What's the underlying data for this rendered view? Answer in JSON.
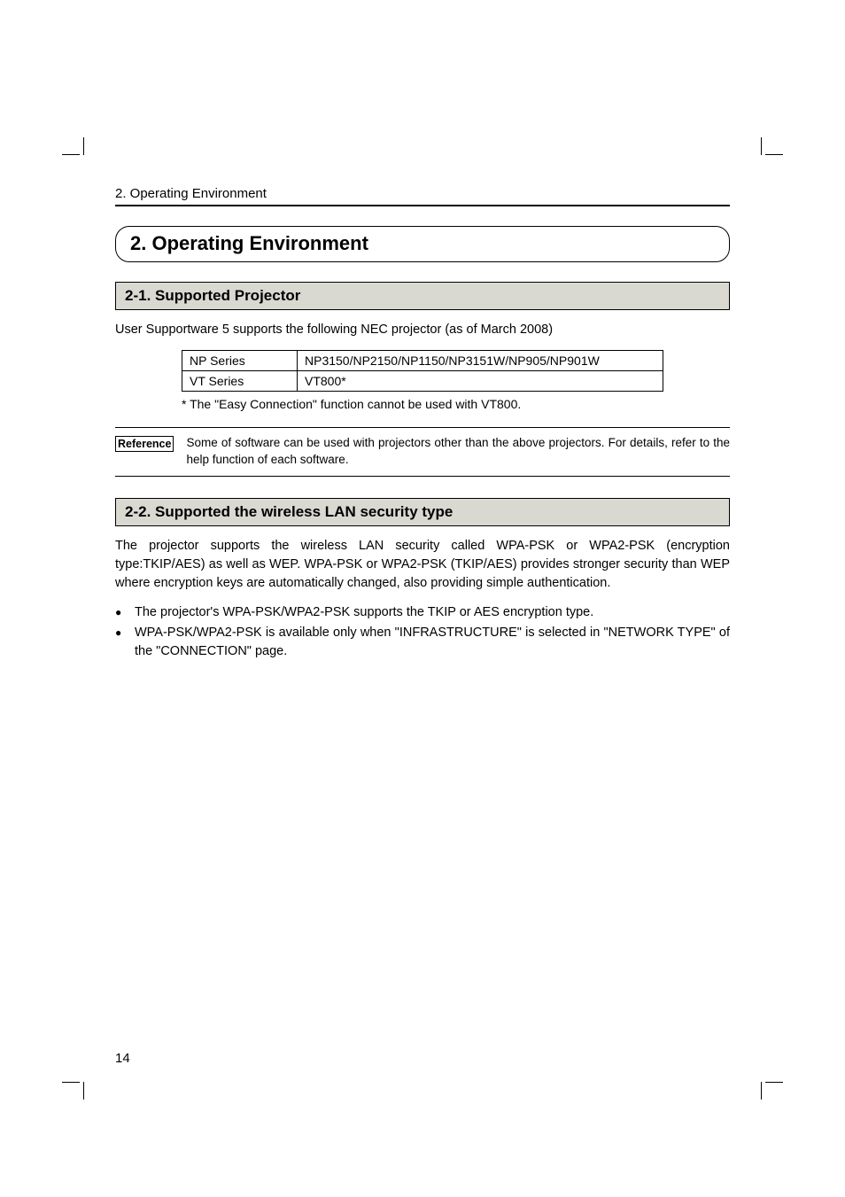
{
  "runningHead": "2. Operating Environment",
  "chapterTitle": "2. Operating Environment",
  "section1": {
    "heading": "2-1.  Supported Projector",
    "intro": "User Supportware 5 supports the following NEC projector (as of March 2008)",
    "table": {
      "rows": [
        {
          "series": "NP Series",
          "models": "NP3150/NP2150/NP1150/NP3151W/NP905/NP901W"
        },
        {
          "series": "VT Series",
          "models": "VT800*"
        }
      ]
    },
    "tableNote": "* The \"Easy Connection\" function cannot be used with VT800.",
    "reference": {
      "badge": "Reference",
      "text": "Some of software can be used with projectors other than the above projectors.  For details, refer to the help function of each software."
    }
  },
  "section2": {
    "heading": "2-2.  Supported the wireless LAN security type",
    "para": "The projector supports the wireless LAN security called WPA-PSK or WPA2-PSK (encryption type:TKIP/AES) as well as WEP. WPA-PSK or WPA2-PSK (TKIP/AES) provides stronger security than WEP where encryption keys are automatically changed, also providing simple authentication.",
    "bullets": [
      "The projector's WPA-PSK/WPA2-PSK supports the TKIP or AES encryption type.",
      "WPA-PSK/WPA2-PSK is available only when \"INFRASTRUCTURE\" is selected in \"NETWORK TYPE\" of the \"CONNECTION\" page."
    ]
  },
  "pageNumber": "14"
}
